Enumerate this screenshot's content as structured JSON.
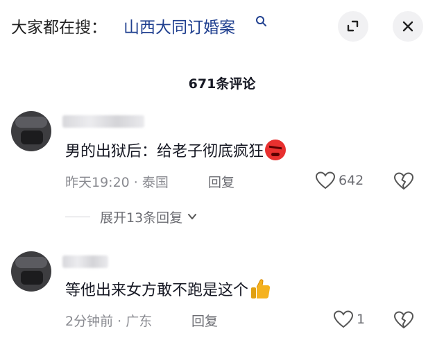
{
  "search": {
    "prefix": "大家都在搜：",
    "term": "山西大同订婚案"
  },
  "header": {
    "comment_count": "671条评论"
  },
  "comments": [
    {
      "text": "男的出狱后：给老子彻底疯狂",
      "emoji": "angry-face-emoji",
      "time": "昨天19:20",
      "location": "泰国",
      "reply_label": "回复",
      "likes": "642",
      "expand_label": "展开13条回复"
    },
    {
      "text": "等他出来女方敢不跑是这个",
      "emoji": "thumbs-up-emoji",
      "time": "2分钟前",
      "location": "广东",
      "reply_label": "回复",
      "likes": "1"
    }
  ],
  "colors": {
    "accent_link": "#1f3f8f",
    "meta_gray": "#8a8b91",
    "emoji_red": "#e8302f",
    "emoji_yellow": "#f5b21f"
  }
}
